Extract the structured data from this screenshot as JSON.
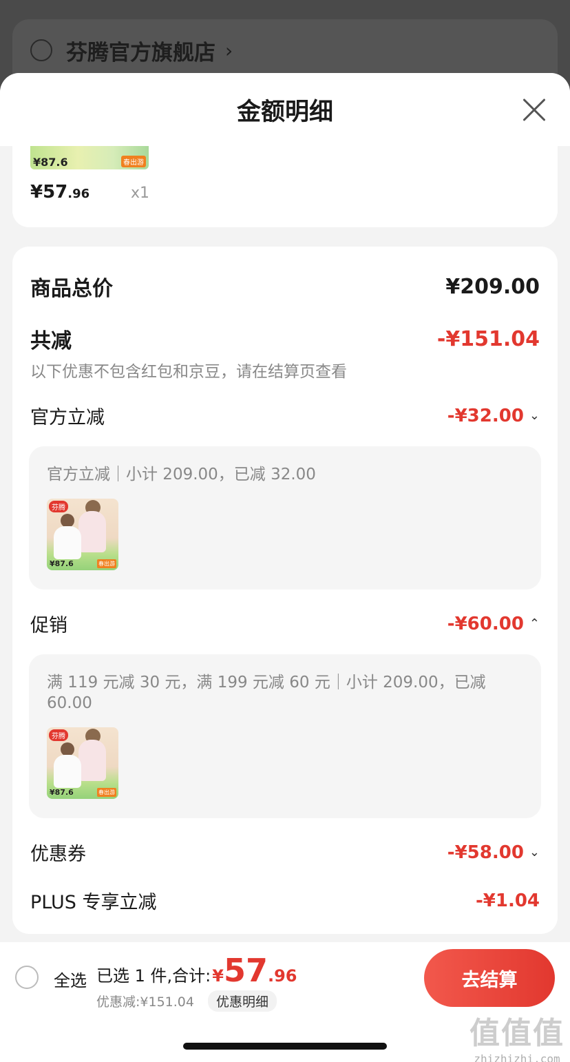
{
  "background": {
    "store_name": "芬腾官方旗舰店",
    "chevron": "›"
  },
  "sheet": {
    "title": "金额明细"
  },
  "top_item": {
    "thumb_price": "87.6",
    "thumb_tag": "春出游",
    "price_symbol": "¥",
    "price_int": "57",
    "price_dec": ".96",
    "qty": "x1"
  },
  "summary": {
    "total_label": "商品总价",
    "total_value": "¥209.00",
    "reduce_label": "共减",
    "reduce_value": "-¥151.04",
    "note": "以下优惠不包含红包和京豆，请在结算页查看"
  },
  "official": {
    "label": "官方立减",
    "value": "-¥32.00",
    "chevron": "⌄",
    "detail": "官方立减｜小计 209.00，已减 32.00",
    "thumb_logo": "芬腾",
    "thumb_price": "87.6",
    "thumb_tag": "春出游"
  },
  "promotion": {
    "label": "促销",
    "value": "-¥60.00",
    "chevron": "⌃",
    "detail": "满 119 元减 30 元，满 199 元减 60 元｜小计 209.00，已减 60.00",
    "thumb_logo": "芬腾",
    "thumb_price": "87.6",
    "thumb_tag": "春出游"
  },
  "coupon": {
    "label": "优惠券",
    "value": "-¥58.00",
    "chevron": "⌄"
  },
  "plus": {
    "label": "PLUS 专享立减",
    "value": "-¥1.04"
  },
  "bottom_bar": {
    "select_all": "全选",
    "selected_text": "已选 1 件,合计:",
    "currency": "¥",
    "total_int": "57",
    "total_dec": ".96",
    "discount_text": "优惠减:¥151.04",
    "detail_link": "优惠明细",
    "checkout": "去结算"
  },
  "watermark": {
    "logo": "值值值",
    "url": "zhizhizhi.com"
  },
  "colors": {
    "accent_red": "#e2382f",
    "text_gray": "#888888"
  }
}
